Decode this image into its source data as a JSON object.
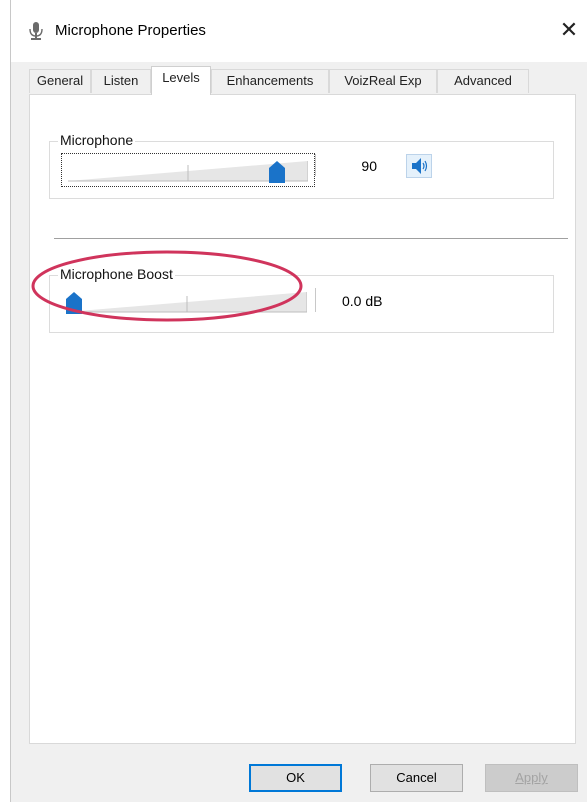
{
  "window": {
    "title": "Microphone Properties",
    "close_glyph": "✕"
  },
  "tabs": [
    {
      "label": "General",
      "active": false
    },
    {
      "label": "Listen",
      "active": false
    },
    {
      "label": "Levels",
      "active": true
    },
    {
      "label": "Enhancements",
      "active": false
    },
    {
      "label": "VoizReal Exp",
      "active": false
    },
    {
      "label": "Advanced",
      "active": false
    }
  ],
  "levels": {
    "microphone": {
      "label": "Microphone",
      "value": "90",
      "level_fraction": 0.9,
      "icon": "speaker-icon"
    },
    "boost": {
      "label": "Microphone Boost",
      "value": "0.0 dB",
      "level_fraction": 0.0
    }
  },
  "annotation": {
    "highlight_color": "#d0345c"
  },
  "buttons": {
    "ok": "OK",
    "cancel": "Cancel",
    "apply": "Apply"
  },
  "colors": {
    "accent": "#0078d7",
    "thumb": "#1a73c9"
  }
}
